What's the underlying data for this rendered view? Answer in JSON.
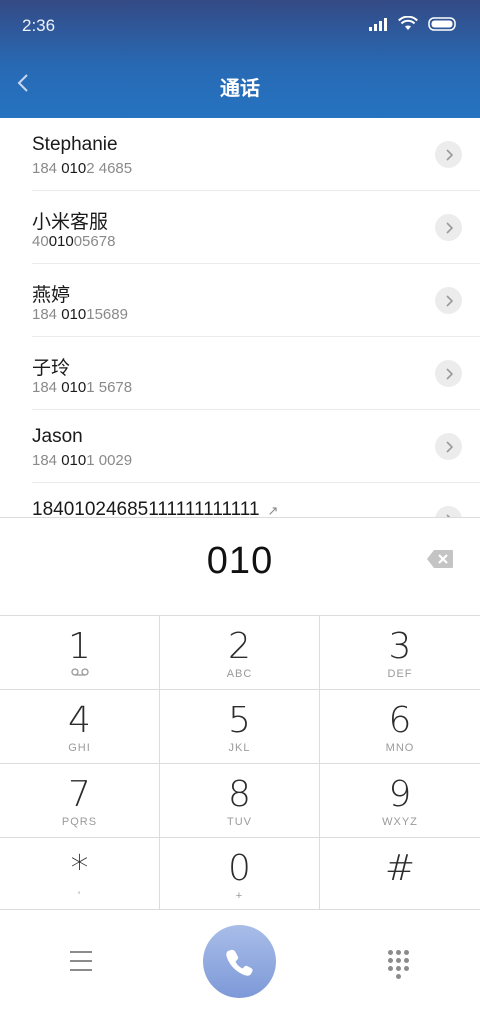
{
  "status": {
    "time": "2:36"
  },
  "header": {
    "title": "通话"
  },
  "results": [
    {
      "name": "Stephanie",
      "number_pre": "184 ",
      "number_hl": "010",
      "number_post": "2 4685"
    },
    {
      "name": "小米客服",
      "number_pre": "40",
      "number_hl": "010",
      "number_post": "05678"
    },
    {
      "name": "燕婷",
      "number_pre": "184 ",
      "number_hl": "010",
      "number_post": "15689"
    },
    {
      "name": "子玲",
      "number_pre": "184 ",
      "number_hl": "010",
      "number_post": "1 5678"
    },
    {
      "name": "Jason",
      "number_pre": "184 ",
      "number_hl": "010",
      "number_post": "1 0029"
    },
    {
      "name": "18401024685111111111111",
      "arrow": "↗"
    }
  ],
  "dialer": {
    "input": "010"
  },
  "keypad": [
    {
      "digit": "1",
      "letters": ""
    },
    {
      "digit": "2",
      "letters": "ABC"
    },
    {
      "digit": "3",
      "letters": "DEF"
    },
    {
      "digit": "4",
      "letters": "GHI"
    },
    {
      "digit": "5",
      "letters": "JKL"
    },
    {
      "digit": "6",
      "letters": "MNO"
    },
    {
      "digit": "7",
      "letters": "PQRS"
    },
    {
      "digit": "8",
      "letters": "TUV"
    },
    {
      "digit": "9",
      "letters": "WXYZ"
    },
    {
      "digit": "*",
      "letters": "'"
    },
    {
      "digit": "0",
      "letters": "+"
    },
    {
      "digit": "#",
      "letters": ""
    }
  ],
  "colors": {
    "accent": "#2869b3",
    "call_button": "#8ea8df"
  },
  "icons": {
    "back": "chevron-left-icon",
    "backspace": "backspace-icon",
    "menu": "menu-icon",
    "call": "phone-icon",
    "keypad": "dialpad-icon",
    "voicemail": "voicemail-icon"
  }
}
